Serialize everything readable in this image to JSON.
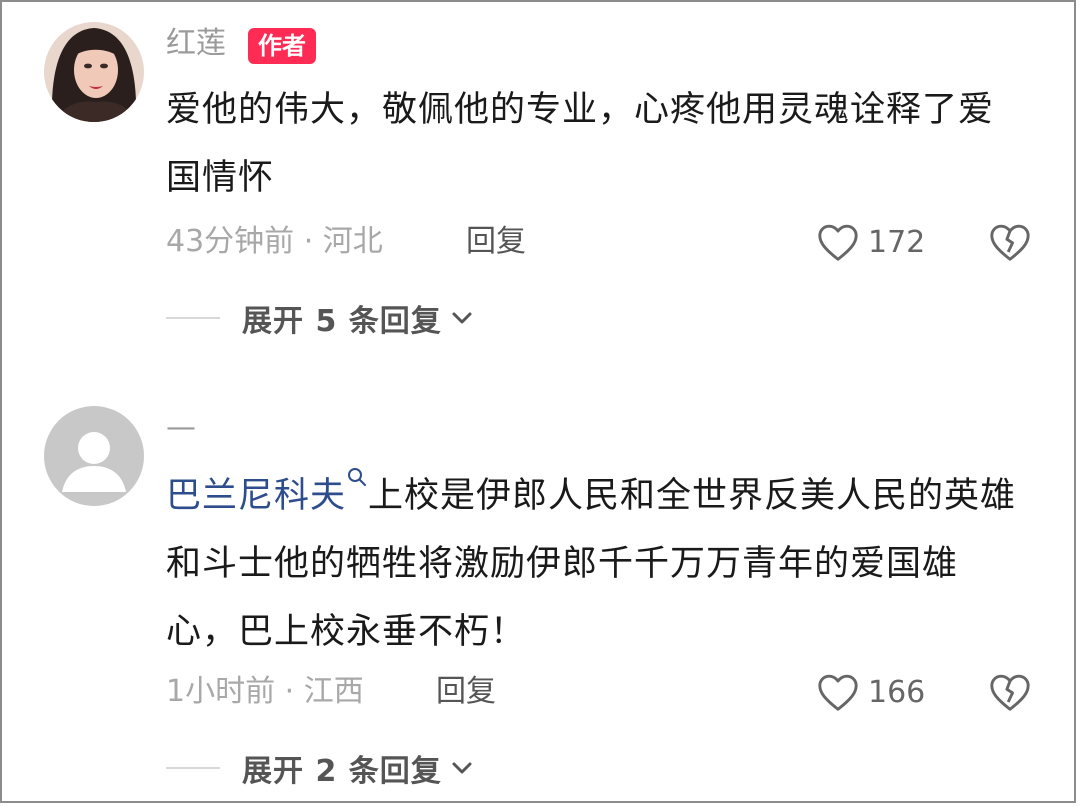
{
  "comments": [
    {
      "username": "红莲",
      "author_tag": "作者",
      "text": "爱他的伟大，敬佩他的专业，心疼他用灵魂诠释了爱国情怀",
      "time_location": "43分钟前 · 河北",
      "reply_label": "回复",
      "likes": "172",
      "expand_label": "展开 5 条回复"
    },
    {
      "username": "—",
      "mention": "巴兰尼科夫",
      "text": "上校是伊郎人民和全世界反美人民的英雄和斗士他的牺牲将激励伊郎千千万万青年的爱国雄心，巴上校永垂不朽！",
      "time_location": "1小时前 · 江西",
      "reply_label": "回复",
      "likes": "166",
      "expand_label": "展开 2 条回复"
    }
  ],
  "colors": {
    "accent": "#fe2c55",
    "mention": "#2d4d8c",
    "muted": "#a8a8a8",
    "text": "#1a1a1a"
  },
  "icons": [
    "heart-outline-icon",
    "broken-heart-icon",
    "chevron-down-icon",
    "search-icon"
  ]
}
